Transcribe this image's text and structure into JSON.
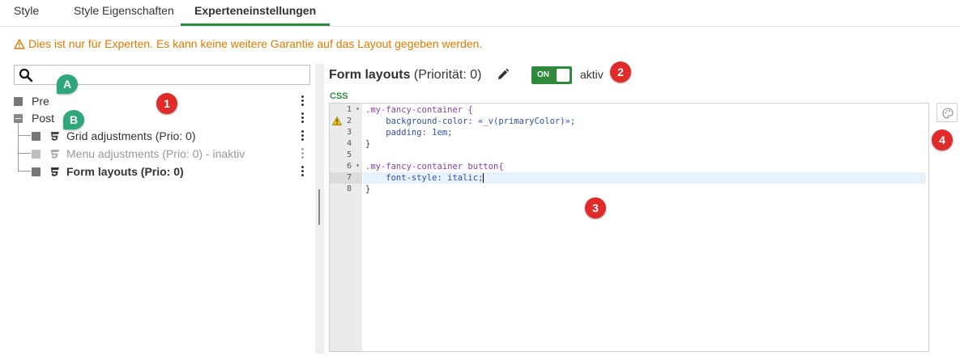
{
  "tabs": [
    {
      "label": "Style"
    },
    {
      "label": "Style Eigenschaften"
    },
    {
      "label": "Experteneinstellungen"
    }
  ],
  "warning": {
    "text": "Dies ist nur für Experten. Es kann keine weitere Garantie auf das Layout gegeben werden.",
    "color": "#e07b00"
  },
  "search": {
    "value": "",
    "placeholder": ""
  },
  "tree": {
    "pre": {
      "label": "Pre"
    },
    "post": {
      "label": "Post"
    },
    "children": [
      {
        "label": "Grid adjustments (Prio: 0)"
      },
      {
        "label": "Menu adjustments (Prio: 0) - inaktiv"
      },
      {
        "label": "Form layouts (Prio: 0)"
      }
    ]
  },
  "editor_header": {
    "title": "Form layouts",
    "priority": "(Priorität: 0)",
    "toggle_label": "ON",
    "status": "aktiv",
    "accent_color": "#2e8b3c"
  },
  "editor": {
    "language": "CSS",
    "line_numbers": [
      "1",
      "2",
      "3",
      "4",
      "5",
      "6",
      "7",
      "8"
    ],
    "lines": [
      ".my-fancy-container {",
      "    background-color: «_v(primaryColor)»;",
      "    padding: 1em;",
      "}",
      "",
      ".my-fancy-container button{",
      "    font-style: italic;",
      "}"
    ]
  },
  "markers": {
    "one": "1",
    "two": "2",
    "three": "3",
    "four": "4",
    "a": "A",
    "b": "B"
  }
}
